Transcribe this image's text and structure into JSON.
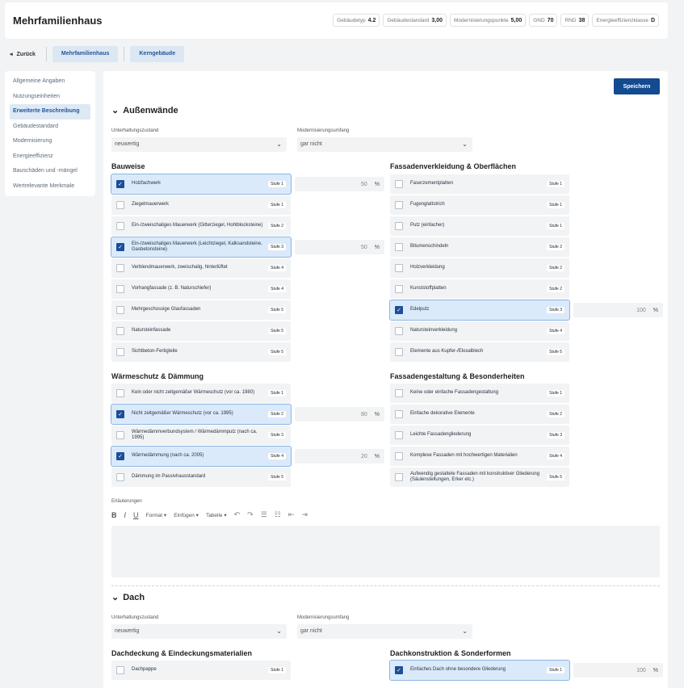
{
  "header": {
    "title": "Mehrfamilienhaus",
    "badges": [
      {
        "label": "Gebäudetyp",
        "value": "4.2"
      },
      {
        "label": "Gebäudestandard",
        "value": "3,00"
      },
      {
        "label": "Modernisierungspunkte",
        "value": "5,00"
      },
      {
        "label": "GND",
        "value": "70"
      },
      {
        "label": "RND",
        "value": "38"
      },
      {
        "label": "Energieeffizienzklasse",
        "value": "D"
      }
    ]
  },
  "nav": {
    "back": "Zurück",
    "crumbs": [
      "Mehrfamilienhaus",
      "Kerngebäude"
    ]
  },
  "sidebar": {
    "items": [
      "Allgemeine Angaben",
      "Nutzungseinheiten",
      "Erweiterte Beschreibung",
      "Gebäudestandard",
      "Modernisierung",
      "Energieeffizienz",
      "Bauschäden und -mängel",
      "Wertrelevante Merkmale"
    ],
    "active": 2
  },
  "save": "Speichern",
  "aussenwaende": {
    "title": "Außenwände",
    "zustand_label": "Unterhaltungszustand",
    "zustand": "neuwertig",
    "umfang_label": "Modernisierungsumfang",
    "umfang": "gar nicht"
  },
  "bauweise": {
    "title": "Bauweise",
    "items": [
      {
        "label": "Holzfachwerk",
        "stufe": "Stufe 1",
        "checked": true,
        "pct": "50"
      },
      {
        "label": "Ziegelmauerwerk",
        "stufe": "Stufe 1",
        "checked": false
      },
      {
        "label": "Ein-/zweischaliges Mauerwerk (Gitterziegel, Hohlblocksteine)",
        "stufe": "Stufe 2",
        "checked": false
      },
      {
        "label": "Ein-/zweischaliges Mauerwerk (Leichtziegel, Kalksandsteine, Gasbetonsteine)",
        "stufe": "Stufe 3",
        "checked": true,
        "pct": "50"
      },
      {
        "label": "Verblendmauerwerk, zweischalig, hinterlüftet",
        "stufe": "Stufe 4",
        "checked": false
      },
      {
        "label": "Vorhangfassade (z. B. Naturschiefer)",
        "stufe": "Stufe 4",
        "checked": false
      },
      {
        "label": "Mehrgeschossige Glasfassaden",
        "stufe": "Stufe 5",
        "checked": false
      },
      {
        "label": "Natursteinfassade",
        "stufe": "Stufe 5",
        "checked": false
      },
      {
        "label": "Sichtbeton-Fertigteile",
        "stufe": "Stufe 5",
        "checked": false
      }
    ]
  },
  "fassade": {
    "title": "Fassadenverkleidung & Oberflächen",
    "items": [
      {
        "label": "Faserzementplatten",
        "stufe": "Stufe 1",
        "checked": false
      },
      {
        "label": "Fugenglattstrich",
        "stufe": "Stufe 1",
        "checked": false
      },
      {
        "label": "Putz (einfacher)",
        "stufe": "Stufe 1",
        "checked": false
      },
      {
        "label": "Bitumenschindeln",
        "stufe": "Stufe 2",
        "checked": false
      },
      {
        "label": "Holzverkleidung",
        "stufe": "Stufe 2",
        "checked": false
      },
      {
        "label": "Kunststoffplatten",
        "stufe": "Stufe 2",
        "checked": false
      },
      {
        "label": "Edelputz",
        "stufe": "Stufe 3",
        "checked": true,
        "pct": "100"
      },
      {
        "label": "Natursteinverkleidung",
        "stufe": "Stufe 4",
        "checked": false
      },
      {
        "label": "Elemente aus Kupfer-/Eloxalblech",
        "stufe": "Stufe 5",
        "checked": false
      }
    ]
  },
  "waerme": {
    "title": "Wärmeschutz & Dämmung",
    "items": [
      {
        "label": "Kein oder nicht zeitgemäßer Wärmeschutz (vor ca. 1980)",
        "stufe": "Stufe 1",
        "checked": false
      },
      {
        "label": "Nicht zeitgemäßer Wärmeschutz (vor ca. 1995)",
        "stufe": "Stufe 2",
        "checked": true,
        "pct": "80"
      },
      {
        "label": "Wärmedämmverbundsystem / Wärmedämmputz (nach ca. 1995)",
        "stufe": "Stufe 3",
        "checked": false
      },
      {
        "label": "Wärmedämmung (nach ca. 2005)",
        "stufe": "Stufe 4",
        "checked": true,
        "pct": "20"
      },
      {
        "label": "Dämmung im Passivhausstandard",
        "stufe": "Stufe 5",
        "checked": false
      }
    ]
  },
  "gestaltung": {
    "title": "Fassadengestaltung & Besonderheiten",
    "items": [
      {
        "label": "Keine oder einfache Fassadengestaltung",
        "stufe": "Stufe 1",
        "checked": false
      },
      {
        "label": "Einfache dekorative Elemente",
        "stufe": "Stufe 2",
        "checked": false
      },
      {
        "label": "Leichte Fassadengliederung",
        "stufe": "Stufe 3",
        "checked": false
      },
      {
        "label": "Komplexe Fassaden mit hochwertigen Materialien",
        "stufe": "Stufe 4",
        "checked": false
      },
      {
        "label": "Aufwendig gestaltete Fassaden mit konstruktiver Gliederung (Säulenstellungen, Erker etc.)",
        "stufe": "Stufe 5",
        "checked": false
      }
    ]
  },
  "editor": {
    "label": "Erläuterungen",
    "format": "Format",
    "einfuegen": "Einfügen",
    "tabelle": "Tabelle"
  },
  "dach": {
    "title": "Dach",
    "zustand_label": "Unterhaltungszustand",
    "zustand": "neuwertig",
    "umfang_label": "Modernisierungsumfang",
    "umfang": "gar nicht"
  },
  "dachdeckung": {
    "title": "Dachdeckung & Eindeckungsmaterialien",
    "items": [
      {
        "label": "Dachpappe",
        "stufe": "Stufe 1",
        "checked": false
      }
    ]
  },
  "dachkonstruktion": {
    "title": "Dachkonstruktion & Sonderformen",
    "items": [
      {
        "label": "Einfaches Dach ohne besondere Gliederung",
        "stufe": "Stufe 1",
        "checked": true,
        "pct": "100"
      }
    ]
  },
  "percent_sign": "%"
}
